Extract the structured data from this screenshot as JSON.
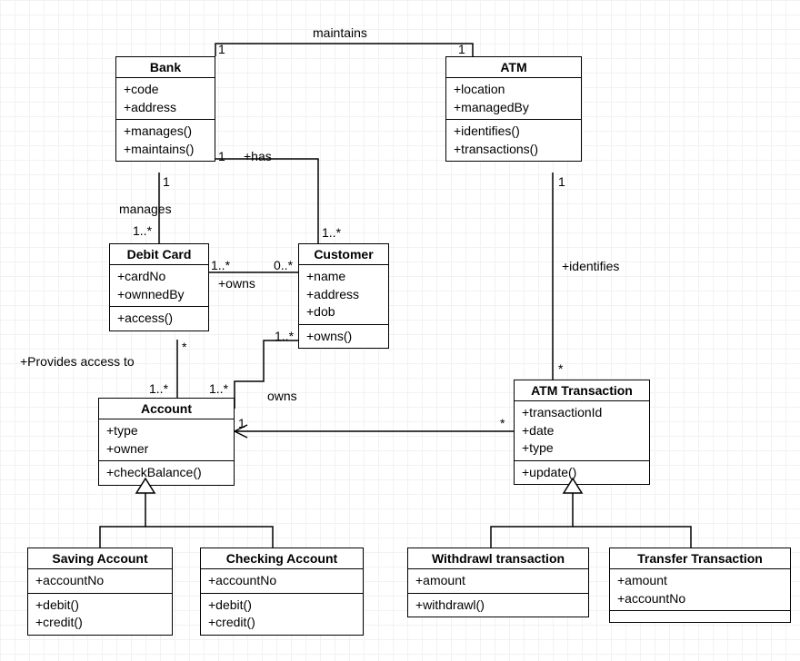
{
  "classes": {
    "bank": {
      "name": "Bank",
      "attrs": [
        "+code",
        "+address"
      ],
      "ops": [
        "+manages()",
        "+maintains()"
      ]
    },
    "atm": {
      "name": "ATM",
      "attrs": [
        "+location",
        "+managedBy"
      ],
      "ops": [
        "+identifies()",
        "+transactions()"
      ]
    },
    "debitcard": {
      "name": "Debit Card",
      "attrs": [
        "+cardNo",
        "+ownnedBy"
      ],
      "ops": [
        "+access()"
      ]
    },
    "customer": {
      "name": "Customer",
      "attrs": [
        "+name",
        "+address",
        "+dob"
      ],
      "ops": [
        "+owns()"
      ]
    },
    "account": {
      "name": "Account",
      "attrs": [
        "+type",
        "+owner"
      ],
      "ops": [
        "+checkBalance()"
      ]
    },
    "atmtxn": {
      "name": "ATM Transaction",
      "attrs": [
        "+transactionId",
        "+date",
        "+type"
      ],
      "ops": [
        "+update()"
      ]
    },
    "saving": {
      "name": "Saving Account",
      "attrs": [
        "+accountNo"
      ],
      "ops": [
        "+debit()",
        "+credit()"
      ]
    },
    "checking": {
      "name": "Checking Account",
      "attrs": [
        "+accountNo"
      ],
      "ops": [
        "+debit()",
        "+credit()"
      ]
    },
    "withdrawl": {
      "name": "Withdrawl transaction",
      "attrs": [
        "+amount"
      ],
      "ops": [
        "+withdrawl()"
      ]
    },
    "transfer": {
      "name": "Transfer Transaction",
      "attrs": [
        "+amount",
        "+accountNo"
      ],
      "ops": []
    }
  },
  "relationships": [
    {
      "name": "maintains",
      "from": "Bank",
      "to": "ATM",
      "from_mult": "1",
      "to_mult": "1"
    },
    {
      "name": "manages",
      "from": "Bank",
      "to": "Debit Card",
      "from_mult": "1",
      "to_mult": "1..*"
    },
    {
      "name": "+has",
      "from": "Bank",
      "to": "Customer",
      "from_mult": "1",
      "to_mult": "1..*"
    },
    {
      "name": "+owns",
      "from": "Debit Card",
      "to": "Customer",
      "from_mult": "1..*",
      "to_mult": "0..*"
    },
    {
      "name": "+Provides access to",
      "from": "Debit Card",
      "to": "Account",
      "from_mult": "*",
      "to_mult": "1..*"
    },
    {
      "name": "owns",
      "from": "Customer",
      "to": "Account",
      "from_mult": "1..*",
      "to_mult": "1..*"
    },
    {
      "name": "+identifies",
      "from": "ATM",
      "to": "ATM Transaction",
      "from_mult": "1",
      "to_mult": "*"
    },
    {
      "name": "",
      "from": "ATM Transaction",
      "to": "Account",
      "from_mult": "*",
      "to_mult": "1",
      "arrow": "open"
    }
  ],
  "generalizations": [
    {
      "parent": "Account",
      "children": [
        "Saving Account",
        "Checking Account"
      ]
    },
    {
      "parent": "ATM Transaction",
      "children": [
        "Withdrawl transaction",
        "Transfer Transaction"
      ]
    }
  ],
  "labels": {
    "maintains": "maintains",
    "m_b1": "1",
    "m_a1": "1",
    "manages": "manages",
    "m_bank1": "1",
    "m_dc": "1..*",
    "has": "+has",
    "h_b1": "1",
    "h_c": "1..*",
    "owns": "+owns",
    "o_dc": "1..*",
    "o_cu": "0..*",
    "provides": "+Provides access to",
    "p_dc": "*",
    "p_ac": "1..*",
    "owns2": "owns",
    "o2_cu": "1..*",
    "o2_ac": "1..*",
    "identifies": "+identifies",
    "i_a": "1",
    "i_t": "*",
    "tx_acc_from": "*",
    "tx_acc_to": "1"
  }
}
